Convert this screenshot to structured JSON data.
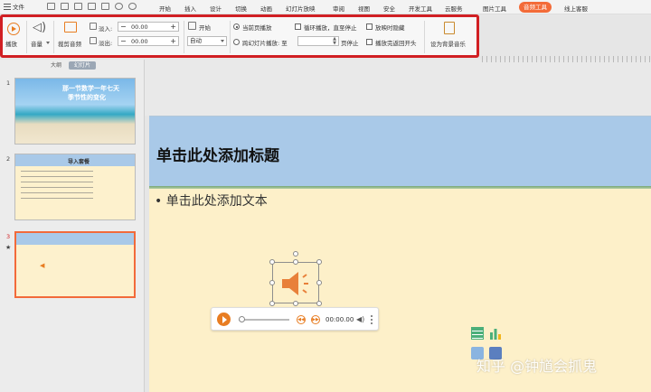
{
  "menubar": {
    "file_label": "文件",
    "items": [
      "开始",
      "插入",
      "设计",
      "切换",
      "动画",
      "幻灯片放映",
      "审阅",
      "视图",
      "安全",
      "开发工具",
      "云服务",
      "图片工具"
    ],
    "active_tab": "音频工具",
    "last_item": "线上客服"
  },
  "ribbon": {
    "play_label": "播放",
    "volume_label": "音量",
    "trim_label": "裁剪音频",
    "fade_in_label": "淡入:",
    "fade_in_value": "00.00",
    "fade_out_label": "淡出:",
    "fade_out_value": "00.00",
    "start_label": "开始",
    "start_value": "自动",
    "current_page_label": "当前页播放",
    "cross_slide_label": "跨幻灯片播放: 至",
    "page_stop_label": "页停止",
    "loop_label": "循环播放，直至停止",
    "hide_label": "放映时隐藏",
    "rewind_label": "播放完返回开头",
    "bg_music_label": "设为背景音乐"
  },
  "pane": {
    "tabs": [
      "大纲",
      "幻灯片"
    ],
    "slide_numbers": [
      "1",
      "2",
      "3"
    ],
    "thumb1_title_a": "那一节数学一年七天",
    "thumb1_title_b": "季节性的变化",
    "thumb2_title": "导入套餐",
    "star": "★"
  },
  "slide": {
    "title": "单击此处添加标题",
    "body": "• 单击此处添加文本",
    "player_time": "00:00.00"
  },
  "watermark": "知乎 @钟馗会抓鬼",
  "colors": {
    "accent": "#f36b38",
    "highlight_border": "#d11f23",
    "audio_orange": "#e87d22",
    "slide_header": "#a9c9e8",
    "slide_bg": "#fdf0c9"
  }
}
